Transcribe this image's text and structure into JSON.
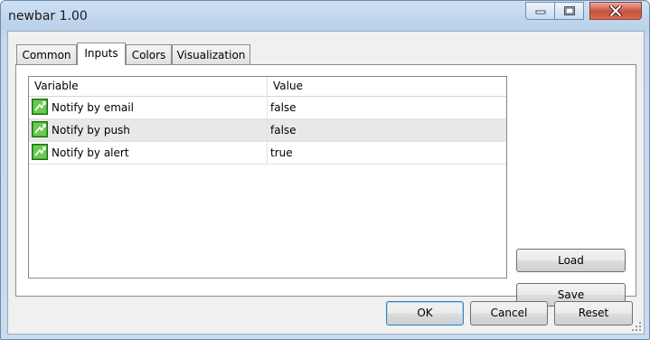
{
  "window": {
    "title": "newbar 1.00"
  },
  "tabs": [
    {
      "label": "Common"
    },
    {
      "label": "Inputs"
    },
    {
      "label": "Colors"
    },
    {
      "label": "Visualization"
    }
  ],
  "active_tab": "Inputs",
  "table": {
    "headers": {
      "variable": "Variable",
      "value": "Value"
    },
    "rows": [
      {
        "variable": "Notify by email",
        "value": "false",
        "icon": "parameter-icon"
      },
      {
        "variable": "Notify by push",
        "value": "false",
        "icon": "parameter-icon"
      },
      {
        "variable": "Notify by alert",
        "value": "true",
        "icon": "parameter-icon"
      }
    ]
  },
  "side_buttons": {
    "load": "Load",
    "save": "Save"
  },
  "footer_buttons": {
    "ok": "OK",
    "cancel": "Cancel",
    "reset": "Reset"
  },
  "colors": {
    "selected_row": "#e8e8e8",
    "icon_green": "#3aa52a"
  }
}
